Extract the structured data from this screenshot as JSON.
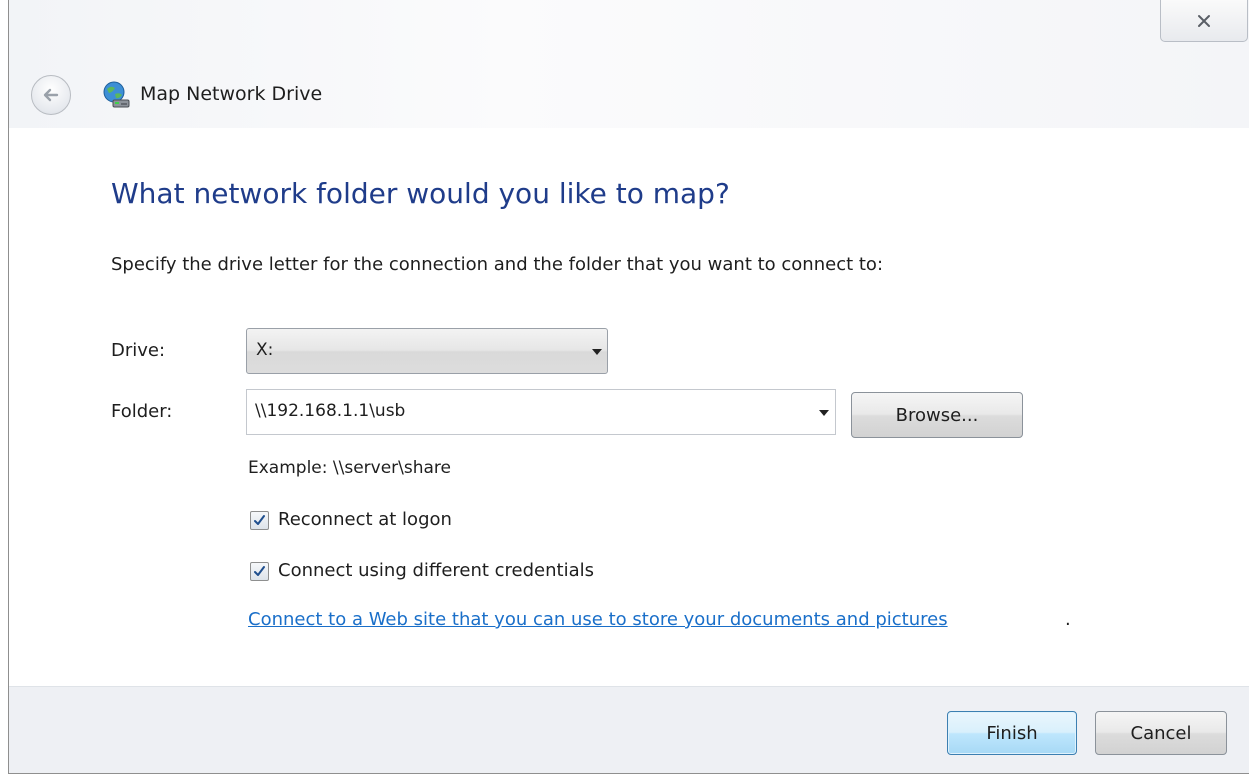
{
  "window": {
    "title": "Map Network Drive",
    "close_glyph": "✕"
  },
  "content": {
    "heading": "What network folder would you like to map?",
    "instruction": "Specify the drive letter for the connection and the folder that you want to connect to:",
    "drive": {
      "label": "Drive:",
      "value": "X:"
    },
    "folder": {
      "label": "Folder:",
      "value": "\\\\192.168.1.1\\usb"
    },
    "browse_label": "Browse...",
    "example": "Example: \\\\server\\share",
    "reconnect": {
      "label": "Reconnect at logon",
      "checked": true
    },
    "credentials": {
      "label": "Connect using different credentials",
      "checked": true
    },
    "web_link": "Connect to a Web site that you can use to store your documents and pictures",
    "web_link_suffix": "."
  },
  "footer": {
    "finish_label": "Finish",
    "cancel_label": "Cancel"
  },
  "icons": {
    "back": "back-arrow-icon",
    "network_drive": "network-drive-icon",
    "close": "close-icon",
    "dropdown": "chevron-down-icon",
    "check": "checkmark-icon"
  },
  "colors": {
    "heading": "#1f3c8a",
    "link": "#1a6fc9",
    "finish_button": "#bee6fd"
  }
}
